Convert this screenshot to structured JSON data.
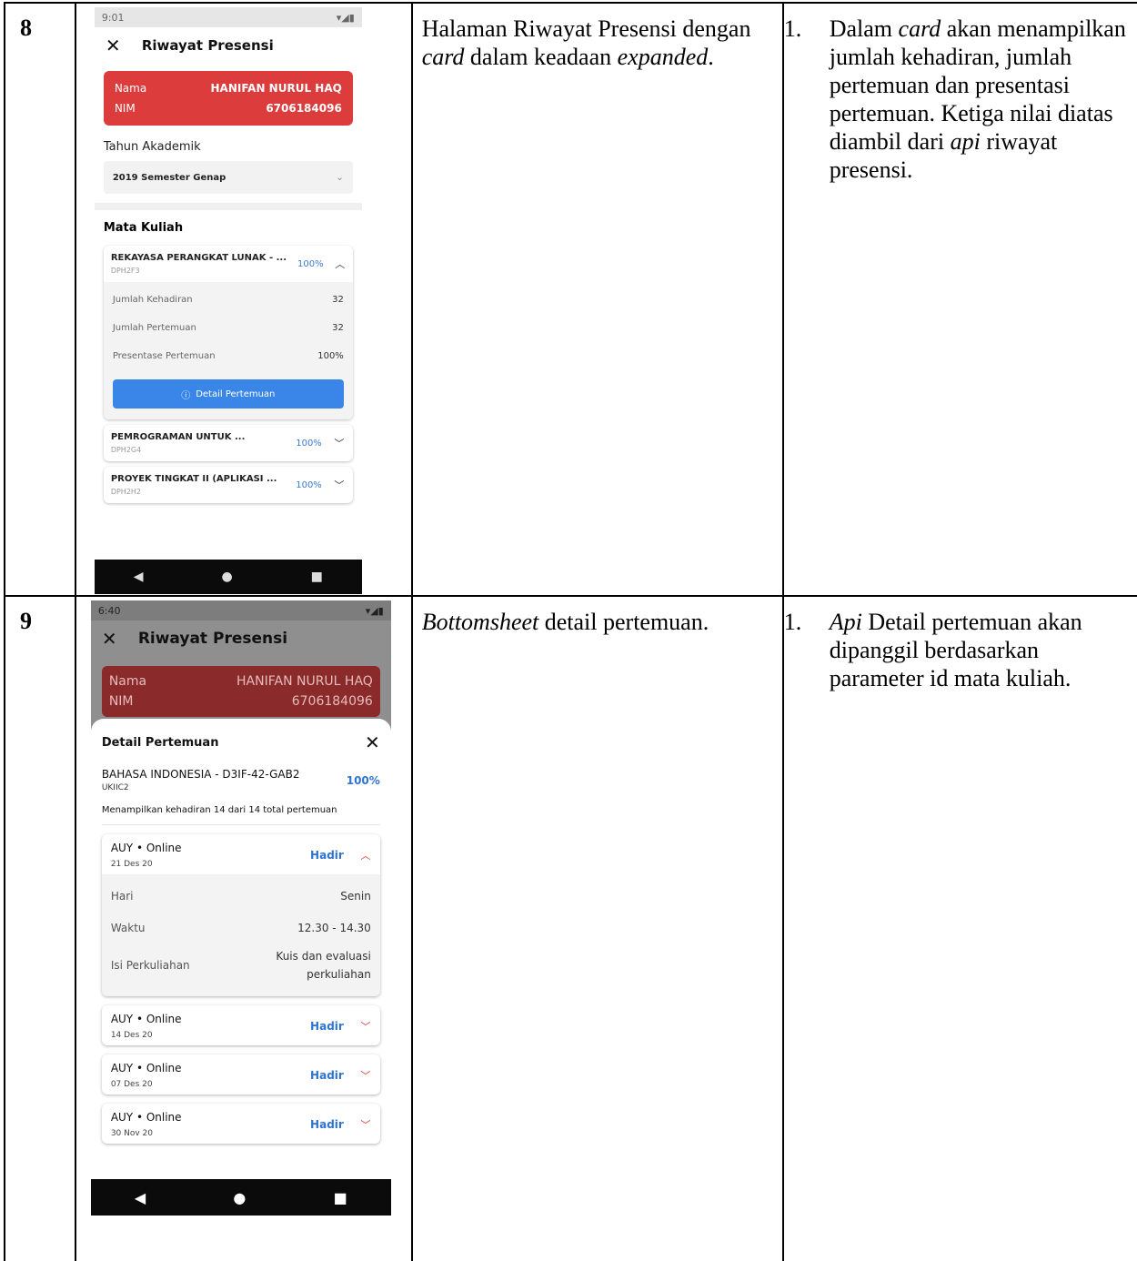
{
  "rows": [
    {
      "num": "8",
      "description": {
        "before": "Halaman Riwayat Presensi dengan ",
        "em1": "card",
        "middle": " dalam keadaan ",
        "em2": "expanded",
        "after": "."
      },
      "note": {
        "idx": "1.",
        "a": "Dalam ",
        "em1": "card",
        "b": " akan menampilkan jumlah kehadiran, jumlah pertemuan dan presentasi pertemuan. Ketiga nilai diatas diambil dari ",
        "em2": "api",
        "c": " riwayat presensi."
      },
      "phone": {
        "status_time": "9:01",
        "title": "Riwayat Presensi",
        "name_label": "Nama",
        "name_value": "HANIFAN NURUL HAQ",
        "nim_label": "NIM",
        "nim_value": "6706184096",
        "year_label": "Tahun Akademik",
        "year_value": "2019 Semester Genap",
        "section": "Mata Kuliah",
        "courses": [
          {
            "name": "REKAYASA PERANGKAT LUNAK - ...",
            "code": "DPH2F3",
            "pct": "100%"
          },
          {
            "name": "PEMROGRAMAN UNTUK ...",
            "code": "DPH2G4",
            "pct": "100%"
          },
          {
            "name": "PROYEK TINGKAT II (APLIKASI ...",
            "code": "DPH2H2",
            "pct": "100%"
          }
        ],
        "details": [
          {
            "label": "Jumlah Kehadiran",
            "value": "32"
          },
          {
            "label": "Jumlah Pertemuan",
            "value": "32"
          },
          {
            "label": "Presentase Pertemuan",
            "value": "100%"
          }
        ],
        "button": "Detail Pertemuan"
      }
    },
    {
      "num": "9",
      "description": {
        "em": "Bottomsheet",
        "after": " detail pertemuan."
      },
      "note": {
        "idx": "1.",
        "em": "Api",
        "a": " Detail pertemuan akan dipanggil berdasarkan parameter id mata kuliah."
      },
      "phone": {
        "status_time": "6:40",
        "title": "Riwayat Presensi",
        "name_label": "Nama",
        "name_value": "HANIFAN NURUL HAQ",
        "nim_label": "NIM",
        "nim_value": "6706184096",
        "sheet_title": "Detail Pertemuan",
        "course_name": "BAHASA INDONESIA - D3IF-42-GAB2",
        "course_code": "UKIIC2",
        "course_pct": "100%",
        "summary": "Menampilkan kehadiran 14 dari 14 total pertemuan",
        "meetings": [
          {
            "title": "AUY • Online",
            "date": "21 Des 20",
            "status": "Hadir"
          },
          {
            "title": "AUY • Online",
            "date": "14 Des 20",
            "status": "Hadir"
          },
          {
            "title": "AUY • Online",
            "date": "07 Des 20",
            "status": "Hadir"
          },
          {
            "title": "AUY • Online",
            "date": "30 Nov 20",
            "status": "Hadir"
          }
        ],
        "meeting_details": [
          {
            "label": "Hari",
            "value": "Senin"
          },
          {
            "label": "Waktu",
            "value": "12.30 - 14.30"
          },
          {
            "label": "Isi Perkuliahan",
            "value": "Kuis dan evaluasi perkuliahan"
          }
        ]
      }
    }
  ],
  "icons": {
    "close": "close-icon",
    "chevron_up": "chevron-up-icon",
    "chevron_down": "chevron-down-icon",
    "info": "info-icon",
    "nav_back": "back-icon",
    "nav_home": "home-icon",
    "nav_recent": "recent-icon"
  },
  "colors": {
    "red_card": "#dd3c3c",
    "primary_blue": "#3a86e8",
    "chevron_red": "#dd3333"
  }
}
